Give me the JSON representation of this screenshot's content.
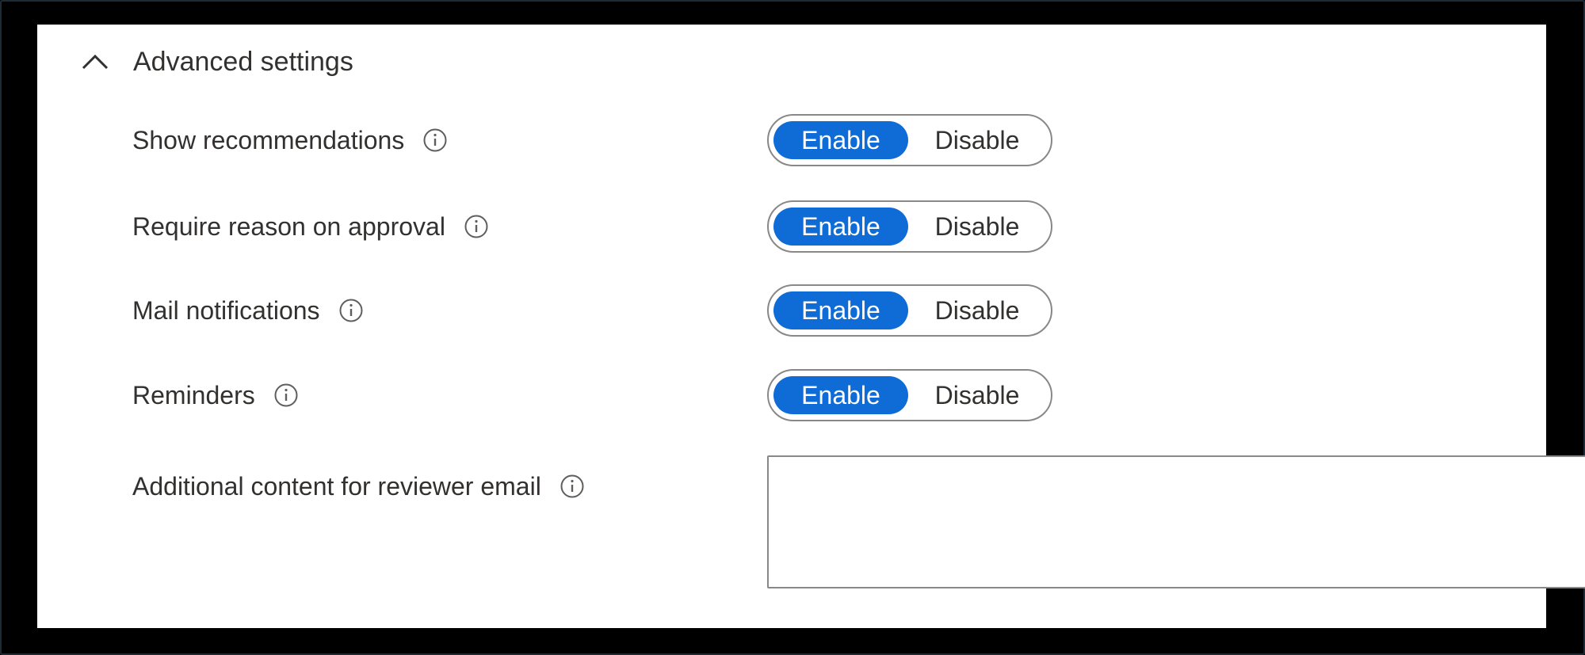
{
  "section": {
    "title": "Advanced settings",
    "expanded": true,
    "icon": "chevron-up-icon"
  },
  "settings": [
    {
      "label": "Show recommendations",
      "info_icon": "info-icon",
      "enable_label": "Enable",
      "disable_label": "Disable",
      "selected": "Enable"
    },
    {
      "label": "Require reason on approval",
      "info_icon": "info-icon",
      "enable_label": "Enable",
      "disable_label": "Disable",
      "selected": "Enable"
    },
    {
      "label": "Mail notifications",
      "info_icon": "info-icon",
      "enable_label": "Enable",
      "disable_label": "Disable",
      "selected": "Enable"
    },
    {
      "label": "Reminders",
      "info_icon": "info-icon",
      "enable_label": "Enable",
      "disable_label": "Disable",
      "selected": "Enable"
    }
  ],
  "reviewer_email": {
    "label": "Additional content for reviewer email",
    "info_icon": "info-icon",
    "value": ""
  },
  "colors": {
    "accent": "#0f6cd6",
    "text": "#323130",
    "border": "#8a8886",
    "background": "#ffffff",
    "frame": "#000000"
  }
}
